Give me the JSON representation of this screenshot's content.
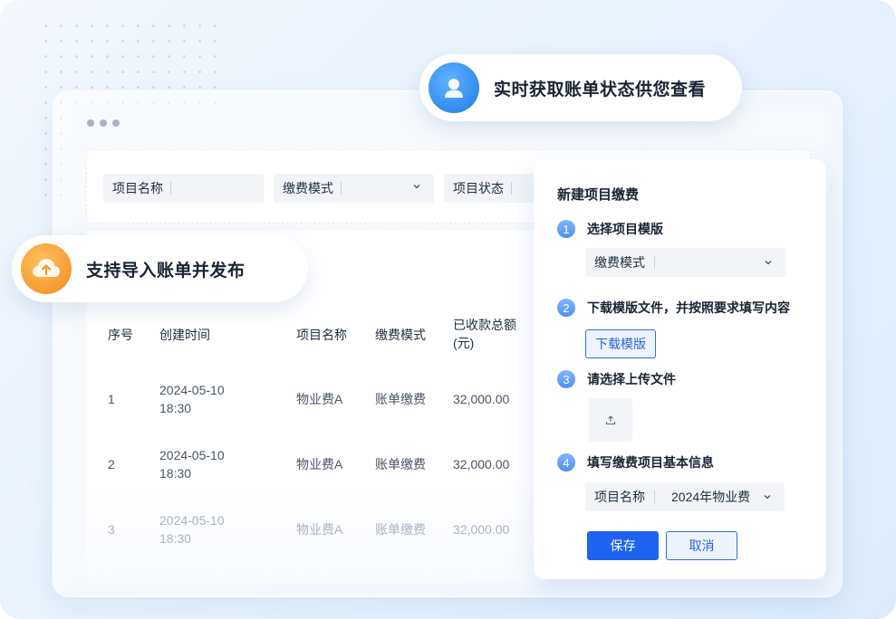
{
  "callouts": {
    "realtime": "实时获取账单状态供您查看",
    "import": "支持导入账单并发布"
  },
  "filters": {
    "project_name": "项目名称",
    "payment_mode": "缴费模式",
    "project_status": "项目状态"
  },
  "table": {
    "headers": [
      "序号",
      "创建时间",
      "项目名称",
      "缴费模式",
      "已收款总额",
      "(元)"
    ],
    "rows": [
      {
        "no": "1",
        "date": "2024-05-10",
        "time": "18:30",
        "name": "物业费A",
        "mode": "账单缴费",
        "amount": "32,000.00"
      },
      {
        "no": "2",
        "date": "2024-05-10",
        "time": "18:30",
        "name": "物业费A",
        "mode": "账单缴费",
        "amount": "32,000.00"
      },
      {
        "no": "3",
        "date": "2024-05-10",
        "time": "18:30",
        "name": "物业费A",
        "mode": "账单缴费",
        "amount": "32,000.00"
      }
    ]
  },
  "dialog": {
    "title": "新建项目缴费",
    "steps": [
      {
        "num": "1",
        "label": "选择项目模版"
      },
      {
        "num": "2",
        "label": "下载模版文件，并按照要求填写内容"
      },
      {
        "num": "3",
        "label": "请选择上传文件"
      },
      {
        "num": "4",
        "label": "填写缴费项目基本信息"
      }
    ],
    "template_select": "缴费模式",
    "download_button": "下载模版",
    "name_field_label": "项目名称",
    "name_field_value": "2024年物业费",
    "save_button": "保存",
    "cancel_button": "取消"
  },
  "colors": {
    "primary": "#1d63ee",
    "orange": "#f7a032",
    "blue_avatar": "#3b8cf0"
  }
}
